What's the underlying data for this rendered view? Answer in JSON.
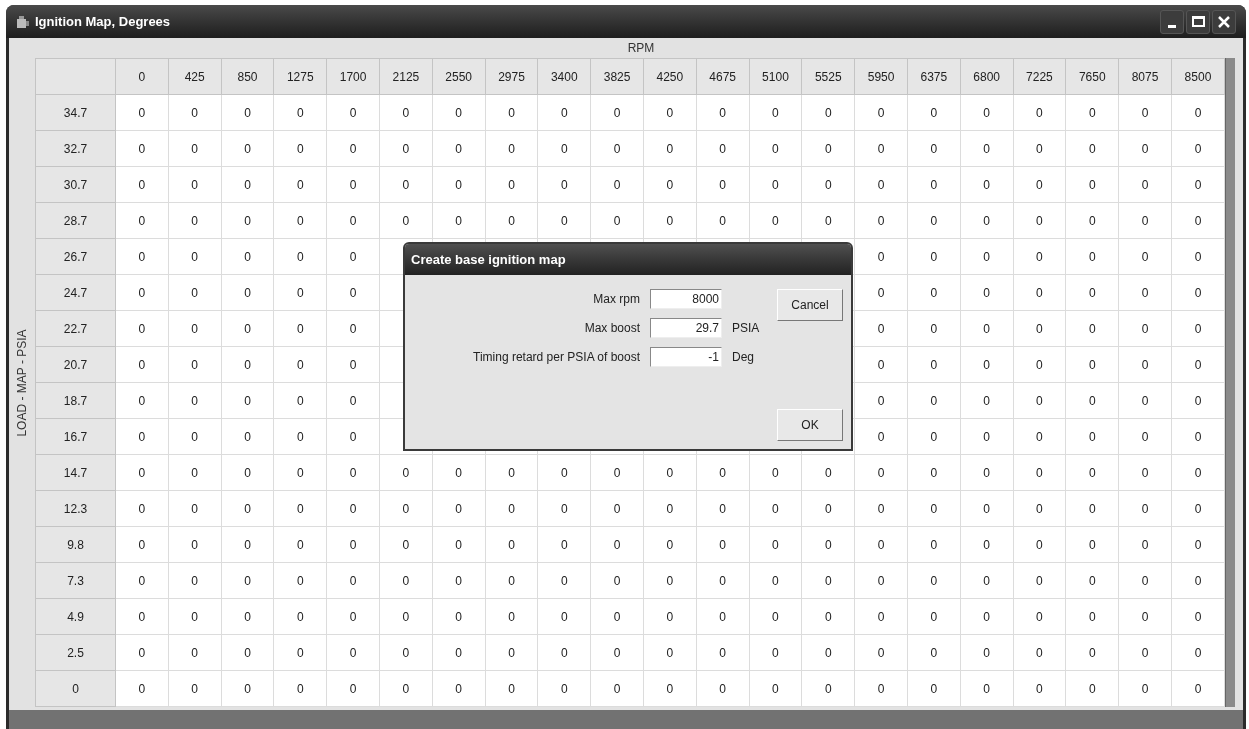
{
  "window": {
    "title": "Ignition Map, Degrees"
  },
  "x_axis_label": "RPM",
  "y_axis_label": "LOAD - MAP - PSIA",
  "columns": [
    "0",
    "425",
    "850",
    "1275",
    "1700",
    "2125",
    "2550",
    "2975",
    "3400",
    "3825",
    "4250",
    "4675",
    "5100",
    "5525",
    "5950",
    "6375",
    "6800",
    "7225",
    "7650",
    "8075",
    "8500"
  ],
  "rows": [
    {
      "load": "34.7",
      "cells": [
        "0",
        "0",
        "0",
        "0",
        "0",
        "0",
        "0",
        "0",
        "0",
        "0",
        "0",
        "0",
        "0",
        "0",
        "0",
        "0",
        "0",
        "0",
        "0",
        "0",
        "0"
      ]
    },
    {
      "load": "32.7",
      "cells": [
        "0",
        "0",
        "0",
        "0",
        "0",
        "0",
        "0",
        "0",
        "0",
        "0",
        "0",
        "0",
        "0",
        "0",
        "0",
        "0",
        "0",
        "0",
        "0",
        "0",
        "0"
      ]
    },
    {
      "load": "30.7",
      "cells": [
        "0",
        "0",
        "0",
        "0",
        "0",
        "0",
        "0",
        "0",
        "0",
        "0",
        "0",
        "0",
        "0",
        "0",
        "0",
        "0",
        "0",
        "0",
        "0",
        "0",
        "0"
      ]
    },
    {
      "load": "28.7",
      "cells": [
        "0",
        "0",
        "0",
        "0",
        "0",
        "0",
        "0",
        "0",
        "0",
        "0",
        "0",
        "0",
        "0",
        "0",
        "0",
        "0",
        "0",
        "0",
        "0",
        "0",
        "0"
      ]
    },
    {
      "load": "26.7",
      "cells": [
        "0",
        "0",
        "0",
        "0",
        "0",
        null,
        null,
        null,
        null,
        null,
        null,
        null,
        null,
        null,
        "0",
        "0",
        "0",
        "0",
        "0",
        "0",
        "0"
      ]
    },
    {
      "load": "24.7",
      "cells": [
        "0",
        "0",
        "0",
        "0",
        "0",
        null,
        null,
        null,
        null,
        null,
        null,
        null,
        null,
        null,
        "0",
        "0",
        "0",
        "0",
        "0",
        "0",
        "0"
      ]
    },
    {
      "load": "22.7",
      "cells": [
        "0",
        "0",
        "0",
        "0",
        "0",
        null,
        null,
        null,
        null,
        null,
        null,
        null,
        null,
        null,
        "0",
        "0",
        "0",
        "0",
        "0",
        "0",
        "0"
      ]
    },
    {
      "load": "20.7",
      "cells": [
        "0",
        "0",
        "0",
        "0",
        "0",
        null,
        null,
        null,
        null,
        null,
        null,
        null,
        null,
        null,
        "0",
        "0",
        "0",
        "0",
        "0",
        "0",
        "0"
      ]
    },
    {
      "load": "18.7",
      "cells": [
        "0",
        "0",
        "0",
        "0",
        "0",
        null,
        null,
        null,
        null,
        null,
        null,
        null,
        null,
        null,
        "0",
        "0",
        "0",
        "0",
        "0",
        "0",
        "0"
      ]
    },
    {
      "load": "16.7",
      "cells": [
        "0",
        "0",
        "0",
        "0",
        "0",
        null,
        null,
        null,
        null,
        null,
        null,
        null,
        null,
        null,
        "0",
        "0",
        "0",
        "0",
        "0",
        "0",
        "0"
      ]
    },
    {
      "load": "14.7",
      "cells": [
        "0",
        "0",
        "0",
        "0",
        "0",
        "0",
        "0",
        "0",
        "0",
        "0",
        "0",
        "0",
        "0",
        "0",
        "0",
        "0",
        "0",
        "0",
        "0",
        "0",
        "0"
      ]
    },
    {
      "load": "12.3",
      "cells": [
        "0",
        "0",
        "0",
        "0",
        "0",
        "0",
        "0",
        "0",
        "0",
        "0",
        "0",
        "0",
        "0",
        "0",
        "0",
        "0",
        "0",
        "0",
        "0",
        "0",
        "0"
      ]
    },
    {
      "load": "9.8",
      "cells": [
        "0",
        "0",
        "0",
        "0",
        "0",
        "0",
        "0",
        "0",
        "0",
        "0",
        "0",
        "0",
        "0",
        "0",
        "0",
        "0",
        "0",
        "0",
        "0",
        "0",
        "0"
      ]
    },
    {
      "load": "7.3",
      "cells": [
        "0",
        "0",
        "0",
        "0",
        "0",
        "0",
        "0",
        "0",
        "0",
        "0",
        "0",
        "0",
        "0",
        "0",
        "0",
        "0",
        "0",
        "0",
        "0",
        "0",
        "0"
      ]
    },
    {
      "load": "4.9",
      "cells": [
        "0",
        "0",
        "0",
        "0",
        "0",
        "0",
        "0",
        "0",
        "0",
        "0",
        "0",
        "0",
        "0",
        "0",
        "0",
        "0",
        "0",
        "0",
        "0",
        "0",
        "0"
      ]
    },
    {
      "load": "2.5",
      "cells": [
        "0",
        "0",
        "0",
        "0",
        "0",
        "0",
        "0",
        "0",
        "0",
        "0",
        "0",
        "0",
        "0",
        "0",
        "0",
        "0",
        "0",
        "0",
        "0",
        "0",
        "0"
      ]
    },
    {
      "load": "0",
      "cells": [
        "0",
        "0",
        "0",
        "0",
        "0",
        "0",
        "0",
        "0",
        "0",
        "0",
        "0",
        "0",
        "0",
        "0",
        "0",
        "0",
        "0",
        "0",
        "0",
        "0",
        "0"
      ]
    }
  ],
  "dialog": {
    "title": "Create base ignition map",
    "fields": [
      {
        "label": "Max rpm",
        "value": "8000"
      },
      {
        "label": "Max boost",
        "value": "29.7",
        "unit": "PSIA"
      },
      {
        "label": "Timing retard per PSIA of boost",
        "value": "-1",
        "unit": "Deg"
      }
    ],
    "buttons": [
      "Cancel",
      "OK"
    ]
  }
}
